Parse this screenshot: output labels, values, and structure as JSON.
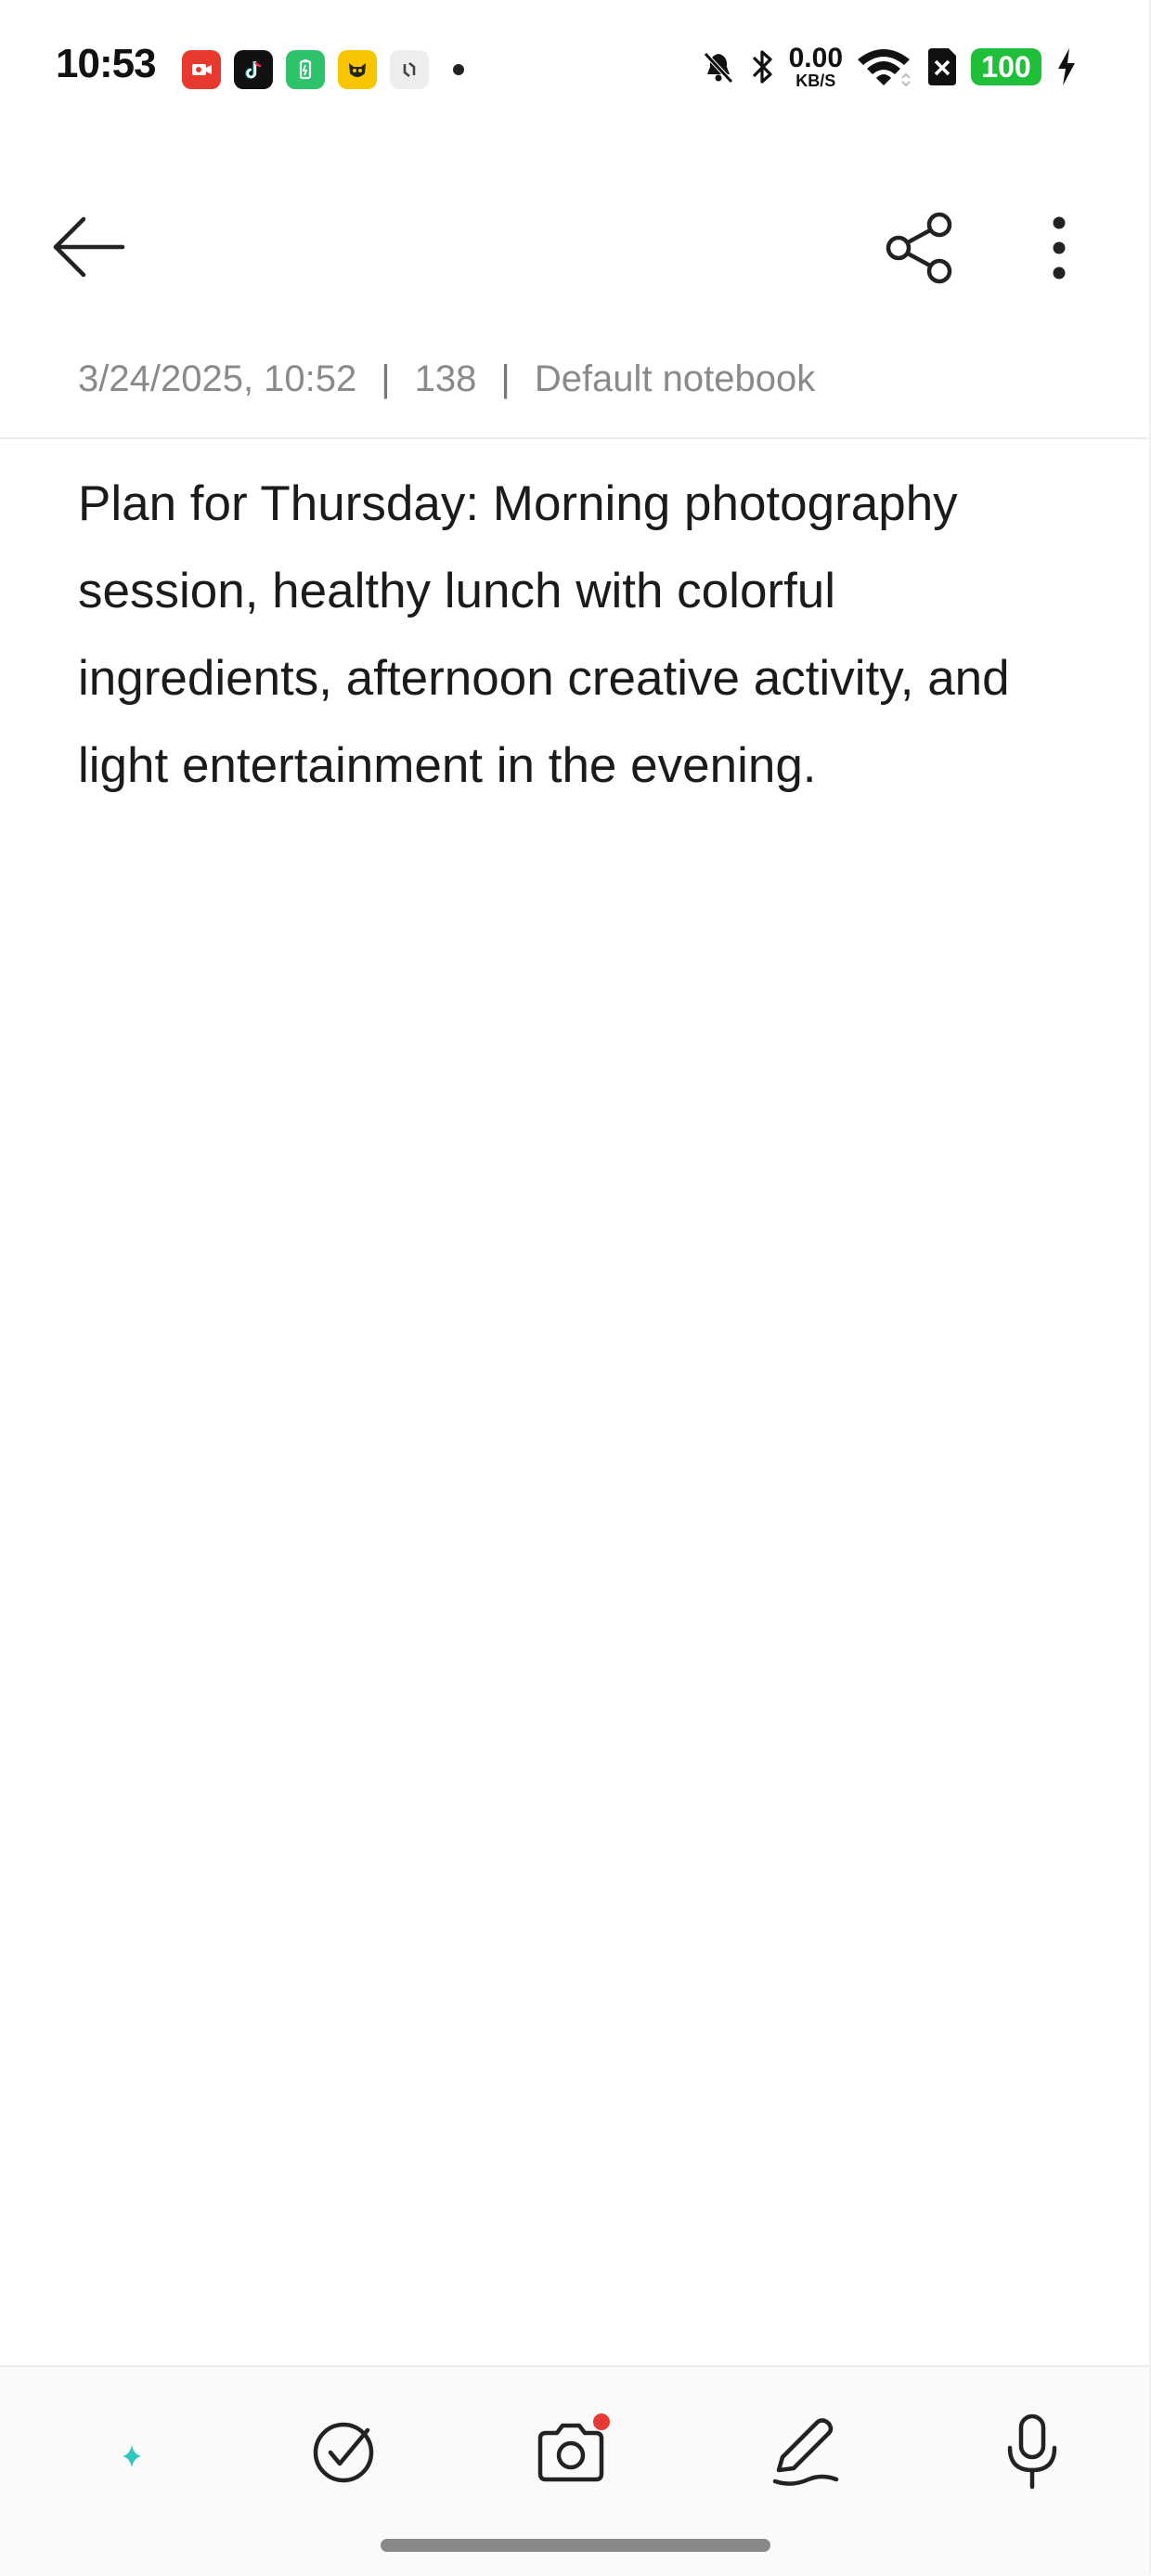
{
  "status_bar": {
    "time": "10:53",
    "net_speed_value": "0.00",
    "net_speed_unit": "KB/S",
    "battery_level": "100",
    "notification_icons": [
      "screen-recorder-icon",
      "tiktok-icon",
      "battery-saver-icon",
      "cat-app-icon",
      "sync-app-icon"
    ],
    "system_icons": [
      "bell-muted-icon",
      "bluetooth-icon",
      "wifi-icon",
      "sim-disabled-icon",
      "battery-icon",
      "charging-icon"
    ]
  },
  "toolbar": {
    "back_icon": "arrow-left-icon",
    "share_icon": "share-icon",
    "more_icon": "more-vertical-icon"
  },
  "note": {
    "date": "3/24/2025, 10:52",
    "char_count": "138",
    "notebook": "Default notebook",
    "separator": "|",
    "content": "Plan for Thursday: Morning photography session, healthy lunch with colorful ingredients, afternoon creative activity, and light entertainment in the evening."
  },
  "bottom_bar": {
    "tools": [
      "ai-format-icon",
      "checklist-icon",
      "camera-icon",
      "handwriting-pen-icon",
      "microphone-icon"
    ]
  },
  "colors": {
    "battery": "#1fbf3a",
    "camera_badge": "#e53935",
    "meta_text": "#8a8a8a"
  }
}
